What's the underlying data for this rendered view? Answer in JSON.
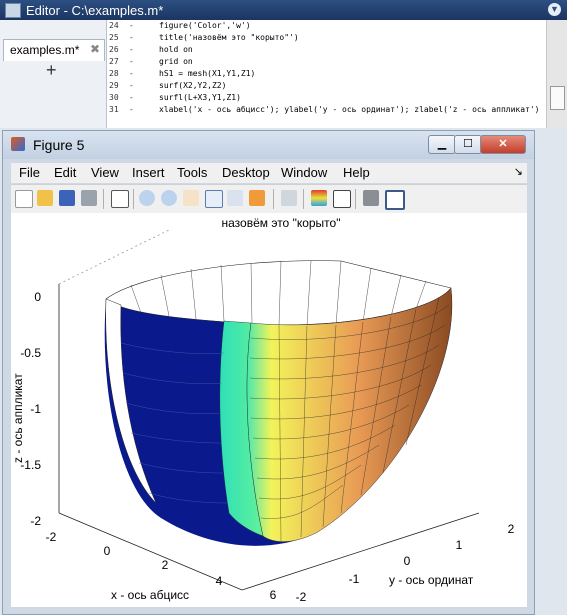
{
  "editor": {
    "title": "Editor - C:\\examples.m*",
    "tab_label": "examples.m*",
    "tab_close": "✖",
    "add_tab": "+",
    "menu_arrow": "▼",
    "lines": [
      {
        "num": "24",
        "dash": "-",
        "code": "figure('Color','w')"
      },
      {
        "num": "25",
        "dash": "-",
        "code": "title('назовём это \"корыто\"')"
      },
      {
        "num": "26",
        "dash": "-",
        "code": "hold on"
      },
      {
        "num": "27",
        "dash": "-",
        "code": "grid on"
      },
      {
        "num": "28",
        "dash": "-",
        "code": "hS1 = mesh(X1,Y1,Z1)"
      },
      {
        "num": "29",
        "dash": "-",
        "code": "surf(X2,Y2,Z2)"
      },
      {
        "num": "30",
        "dash": "-",
        "code": "surfl(L+X3,Y1,Z1)"
      },
      {
        "num": "31",
        "dash": "-",
        "code": "xlabel('x - ось абцисс'); ylabel('y - ось ординат'); zlabel('z - ось аппликат')"
      }
    ]
  },
  "figure": {
    "title": "Figure 5",
    "min_glyph": "▁",
    "max_glyph": "☐",
    "close_glyph": "✕",
    "menu": [
      "File",
      "Edit",
      "View",
      "Insert",
      "Tools",
      "Desktop",
      "Window",
      "Help"
    ],
    "menu_arrow": "↘",
    "toolbar_icons": [
      "new-file-icon",
      "open-folder-icon",
      "save-icon",
      "print-icon",
      "pointer-icon",
      "zoom-in-icon",
      "zoom-out-icon",
      "pan-icon",
      "rotate-icon",
      "data-cursor-icon",
      "brush-icon",
      "link-icon",
      "colorbar-icon",
      "legend-icon",
      "hide-tools-icon",
      "show-tools-icon"
    ]
  },
  "chart_data": {
    "type": "surface",
    "title": "назовём это \"корыто\"",
    "xlabel": "x - ось абцисс",
    "ylabel": "y - ось ординат",
    "zlabel": "z - ось аппликат",
    "xticks": [
      "-2",
      "0",
      "2",
      "4",
      "6"
    ],
    "yticks": [
      "-2",
      "-1",
      "0",
      "1",
      "2"
    ],
    "zticks": [
      "0",
      "-0.5",
      "-1",
      "-1.5",
      "-2"
    ],
    "xlim": [
      -2,
      6
    ],
    "ylim": [
      -2,
      2
    ],
    "zlim": [
      -2,
      0
    ],
    "grid": true,
    "colors": {
      "navy": "#0a1a8c",
      "cyan": "#49e8b0",
      "yellow": "#f3f35a",
      "orange": "#e89a55",
      "copper": "#8a4a22"
    }
  }
}
